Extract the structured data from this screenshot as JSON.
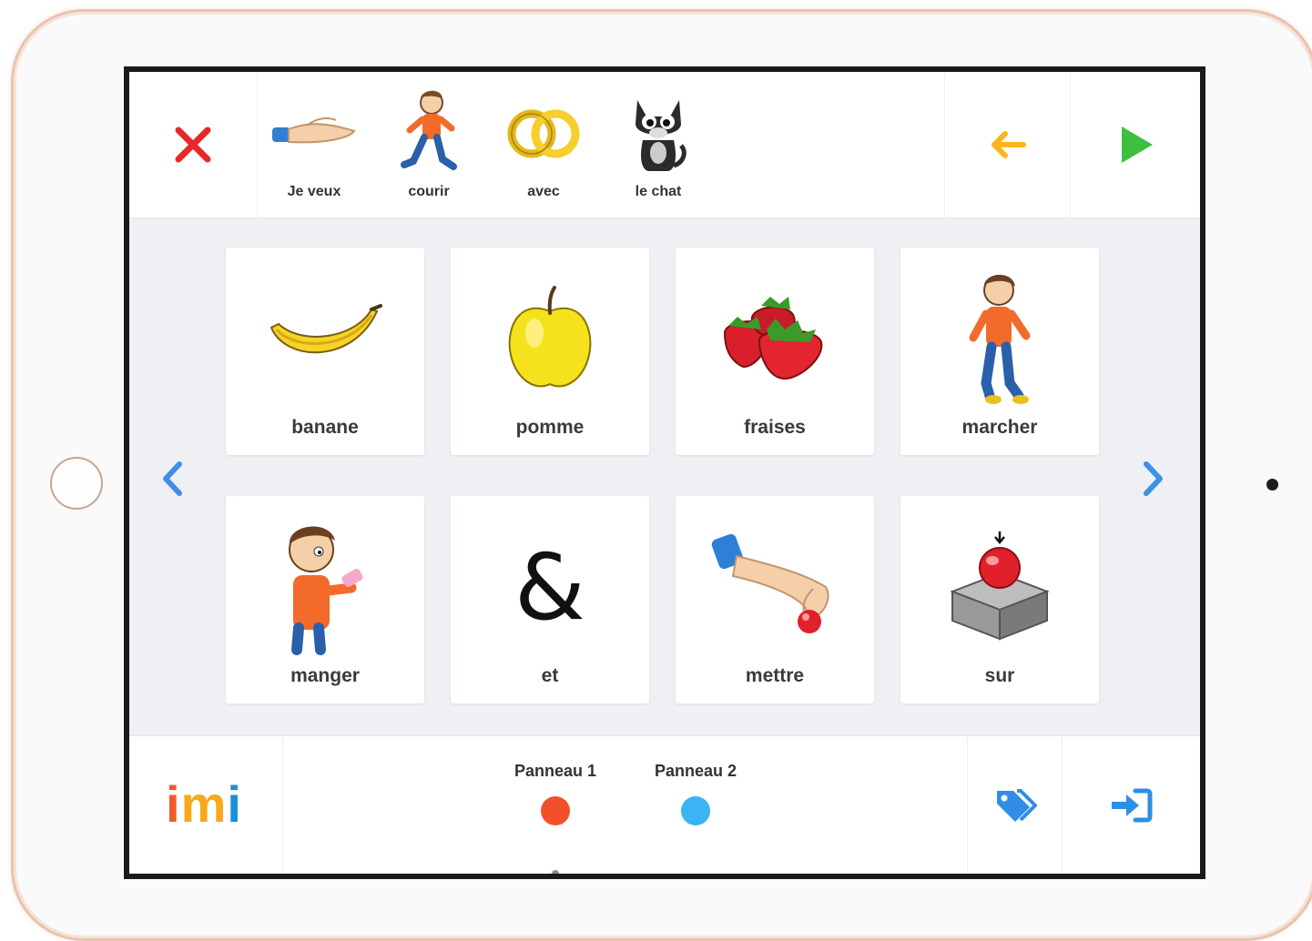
{
  "topbar": {
    "sentence": [
      {
        "label": "Je veux",
        "icon": "hand-offer-icon"
      },
      {
        "label": "courir",
        "icon": "boy-running-icon"
      },
      {
        "label": "avec",
        "icon": "linked-rings-icon"
      },
      {
        "label": "le chat",
        "icon": "cat-icon"
      }
    ],
    "clear_icon": "close-icon",
    "back_icon": "arrow-left-icon",
    "play_icon": "play-icon"
  },
  "grid": {
    "tiles": [
      {
        "label": "banane",
        "icon": "banana-icon"
      },
      {
        "label": "pomme",
        "icon": "apple-icon"
      },
      {
        "label": "fraises",
        "icon": "strawberries-icon"
      },
      {
        "label": "marcher",
        "icon": "boy-walking-icon"
      },
      {
        "label": "manger",
        "icon": "boy-eating-icon"
      },
      {
        "label": "et",
        "icon": "ampersand-icon"
      },
      {
        "label": "mettre",
        "icon": "hand-placing-icon"
      },
      {
        "label": "sur",
        "icon": "ball-on-box-icon"
      }
    ]
  },
  "bottombar": {
    "logo": {
      "letters": [
        "i",
        "m",
        "i"
      ],
      "colors": [
        "#f05a28",
        "#f7a81b",
        "#1d8ed8"
      ]
    },
    "panels": [
      {
        "name": "Panneau 1",
        "color": "#f2502b"
      },
      {
        "name": "Panneau 2",
        "color": "#3ab4f2"
      }
    ],
    "active_panel": 1
  },
  "colors": {
    "close": "#e8282b",
    "back": "#f9b61c",
    "play": "#3fbf3f",
    "nav": "#3f8ee8",
    "tag": "#2f8ee6",
    "login": "#2f8ee6"
  }
}
